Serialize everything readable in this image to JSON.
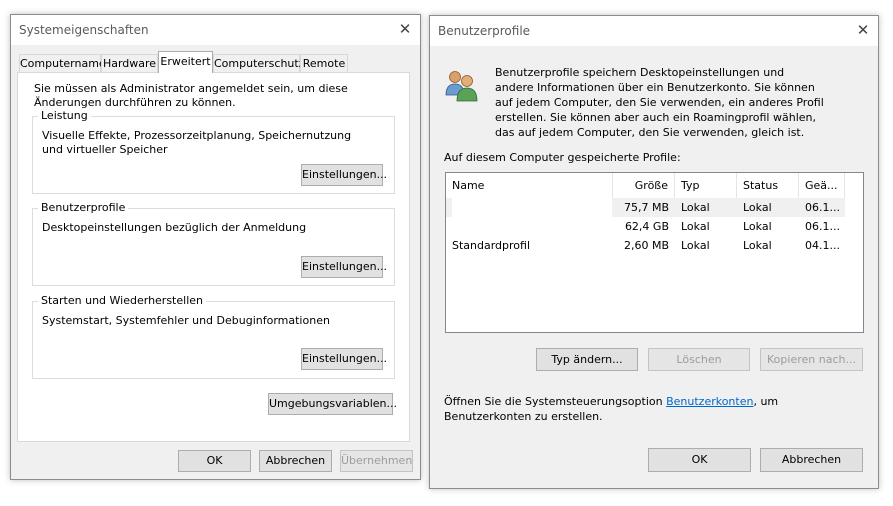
{
  "sysprops": {
    "title": "Systemeigenschaften",
    "tabs": [
      "Computername",
      "Hardware",
      "Erweitert",
      "Computerschutz",
      "Remote"
    ],
    "admin_note": "Sie müssen als Administrator angemeldet sein, um diese Änderungen durchführen zu können.",
    "performance": {
      "title": "Leistung",
      "description": "Visuelle Effekte, Prozessorzeitplanung, Speichernutzung und virtueller Speicher",
      "button": "Einstellungen..."
    },
    "userprofiles": {
      "title": "Benutzerprofile",
      "description": "Desktopeinstellungen bezüglich der Anmeldung",
      "button": "Einstellungen..."
    },
    "startup": {
      "title": "Starten und Wiederherstellen",
      "description": "Systemstart, Systemfehler und Debuginformationen",
      "button": "Einstellungen..."
    },
    "env_button": "Umgebungsvariablen...",
    "ok": "OK",
    "cancel": "Abbrechen",
    "apply": "Übernehmen"
  },
  "profiles": {
    "title": "Benutzerprofile",
    "intro": "Benutzerprofile speichern Desktopeinstellungen und andere Informationen über ein Benutzerkonto. Sie können auf jedem Computer, den Sie verwenden, ein anderes Profil erstellen. Sie können aber auch ein Roamingprofil wählen, das auf jedem Computer, den Sie verwenden, gleich ist.",
    "list_label": "Auf diesem Computer gespeicherte Profile:",
    "columns": [
      "Name",
      "Größe",
      "Typ",
      "Status",
      "Geä..."
    ],
    "rows": [
      {
        "name": "",
        "size": "75,7 MB",
        "type": "Lokal",
        "status": "Lokal",
        "changed": "06.1..."
      },
      {
        "name": "",
        "size": "62,4 GB",
        "type": "Lokal",
        "status": "Lokal",
        "changed": "06.1..."
      },
      {
        "name": "Standardprofil",
        "size": "2,60 MB",
        "type": "Lokal",
        "status": "Lokal",
        "changed": "04.1..."
      }
    ],
    "btn_change_type": "Typ ändern...",
    "btn_delete": "Löschen",
    "btn_copy": "Kopieren nach...",
    "footer_before": "Öffnen Sie die Systemsteuerungsoption ",
    "footer_link": "Benutzerkonten",
    "footer_after": ", um Benutzerkonten zu erstellen.",
    "ok": "OK",
    "cancel": "Abbrechen"
  },
  "icons": {
    "close": "close-icon",
    "users": "users-icon"
  }
}
